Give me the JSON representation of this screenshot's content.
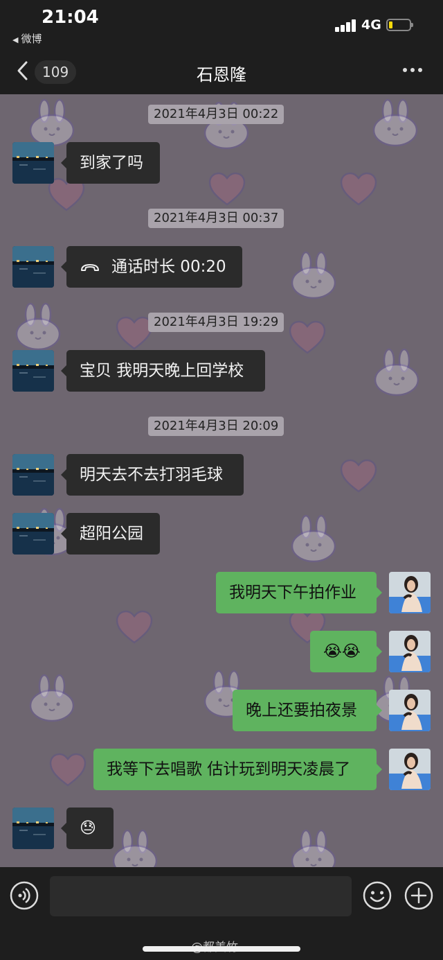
{
  "status_bar": {
    "time": "21:04",
    "back_app": "微博",
    "network": "4G"
  },
  "nav": {
    "unread_count": "109",
    "title": "石恩隆"
  },
  "messages": [
    {
      "type": "timestamp",
      "text": "2021年4月3日 00:22"
    },
    {
      "type": "incoming",
      "text": "到家了吗"
    },
    {
      "type": "timestamp",
      "text": "2021年4月3日 00:37"
    },
    {
      "type": "incoming-call",
      "text": "通话时长 00:20"
    },
    {
      "type": "timestamp",
      "text": "2021年4月3日 19:29"
    },
    {
      "type": "incoming",
      "text": "宝贝 我明天晚上回学校"
    },
    {
      "type": "timestamp",
      "text": "2021年4月3日 20:09"
    },
    {
      "type": "incoming",
      "text": "明天去不去打羽毛球"
    },
    {
      "type": "incoming",
      "text": "超阳公园"
    },
    {
      "type": "outgoing",
      "text": "我明天下午拍作业"
    },
    {
      "type": "outgoing",
      "text": "😭😭"
    },
    {
      "type": "outgoing",
      "text": "晚上还要拍夜景"
    },
    {
      "type": "outgoing",
      "text": "我等下去唱歌 估计玩到明天凌晨了"
    },
    {
      "type": "incoming",
      "text": "😓"
    }
  ],
  "watermark": "@都美竹",
  "icons": {
    "back": "chevron-left-icon",
    "more": "more-dots-icon",
    "call": "phone-hangup-icon",
    "voice": "voice-icon",
    "emoji": "emoji-icon",
    "plus": "plus-icon"
  },
  "colors": {
    "chat_background": "#6e6670",
    "incoming_bubble": "#2b2b2b",
    "outgoing_bubble": "#5fb35f",
    "bar_background": "#1e1e1e"
  }
}
